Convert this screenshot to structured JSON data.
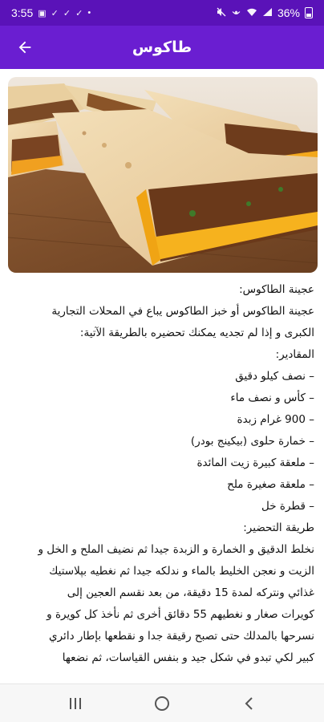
{
  "status_bar": {
    "time": "3:55",
    "battery": "36%"
  },
  "app_bar": {
    "title": "طاكوس"
  },
  "article": {
    "lines": [
      "عجينة الطاكوس:",
      "عجينة الطاكوس أو خبز الطاكوس يباع في المحلات التجارية",
      "الكبرى و إذا لم تجديه يمكنك تحضيره بالطريقة الآتية:",
      "المقادير:",
      "– نصف كيلو دقيق",
      "– كأس و نصف ماء",
      "– 900 غرام زبدة",
      "– خمارة حلوى (بيكينج بودر)",
      "– ملعقة كبيرة زيت المائدة",
      "– ملعقة صغيرة ملح",
      "– قطرة خل",
      "طريقة التحضير:",
      "نخلط الدقيق و الخمارة و الزبدة جيدا ثم نضيف الملح و الخل و",
      "الزيت و نعجن الخليط بالماء و ندلكه جيدا ثم نغطيه بپلاستيك",
      "غذائي ونتركه لمدة 15 دقيقة، من بعد نقسم العجين إلى",
      "كويرات صغار و نغطيهم 55 دقائق أخرى ثم نأخذ كل كويرة و",
      "نسرحها بالمدلك حتى تصبح رقيقة جدا و نقطعها بإطار دائري",
      "كبير لكي تبدو في شكل جيد و بنفس القياسات، ثم نضعها"
    ]
  },
  "icons": {
    "back": "arrow-back-icon",
    "recents": "recents-icon",
    "home": "home-icon",
    "nav_back": "chevron-left-icon"
  },
  "colors": {
    "status_bar": "#5a12b8",
    "app_bar": "#6a1ed1"
  }
}
